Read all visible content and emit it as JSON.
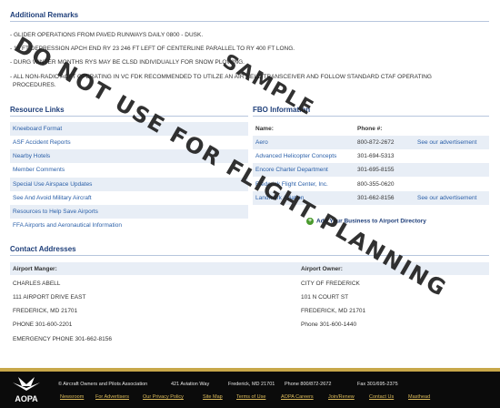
{
  "remarks": {
    "title": "Additional Remarks",
    "items": [
      "- GLIDER OPERATIONS FROM PAVED RUNWAYS DAILY 0800 - DUSK.",
      "- 15 FT DEPRESSION APCH END RY 23 246 FT LEFT OF CENTERLINE PARALLEL TO RY 400 FT LONG.",
      "- DURG WINTER MONTHS RYS MAY BE CLSD INDIVIDUALLY FOR SNOW PLOWING.",
      "- ALL NON-RADIO ACFT OPERATING IN VC FDK RECOMMENDED TO UTILZE AN AIR HELD TRANSCEIVER AND FOLLOW STANDARD CTAF OPERATING",
      "PROCEDURES."
    ]
  },
  "resources": {
    "title": "Resource Links",
    "items": [
      "Kneeboard Format",
      "ASF Accident Reports",
      "Nearby Hotels",
      "Member Comments",
      "Special Use Airspace Updates",
      "See And Avoid Military Aircraft",
      "Resources to Help Save Airports",
      "FFA Airports and Aeronautical Information"
    ]
  },
  "fbo": {
    "title": "FBO Information",
    "name_header": "Name:",
    "phone_header": "Phone #:",
    "rows": [
      {
        "name": "Aero",
        "phone": "800-872-2672",
        "adv": "See our advertisement"
      },
      {
        "name": "Advanced Helicopter Concepts",
        "phone": "301-694-5313",
        "adv": ""
      },
      {
        "name": "Encore Charter Department",
        "phone": "301-695-8155",
        "adv": ""
      },
      {
        "name": "Frederick Flight Center, Inc.",
        "phone": "800-355-0620",
        "adv": ""
      },
      {
        "name": "Landmark Aviation",
        "phone": "301-662-8156",
        "adv": "See our advertisement"
      }
    ],
    "add_business": "Add Your Business to Airport Directory"
  },
  "contacts": {
    "title": "Contact Addresses",
    "manager": {
      "label": "Airport Manger:",
      "lines": [
        "CHARLES ABELL",
        "111 AIRPORT DRIVE EAST",
        "FREDERICK, MD 21701",
        "PHONE 301-600-2201",
        "EMERGENCY PHONE 301-662-8156"
      ]
    },
    "owner": {
      "label": "Airport Owner:",
      "lines": [
        "CITY OF FREDERICK",
        "101 N COURT ST",
        "FREDERICK, MD 21701",
        "Phone 301-600-1440"
      ]
    }
  },
  "watermark": {
    "line1": "DO NOT USE FOR FLIGHT PLANNING",
    "line2": "SAMPLE"
  },
  "footer": {
    "logo_text": "AOPA",
    "info": [
      "© Aircraft Owners and Pilots Association",
      "421 Aviation Way",
      "Frederick, MD 21701",
      "Phone 800/872-2672",
      "Fax 301/695-2375"
    ],
    "links": [
      "Newsroom",
      "For Advertisers",
      "Our Privacy Policy",
      "Site Map",
      "Terms of Use",
      "AOPA Careers",
      "Join/Renew",
      "Contact Us",
      "Masthead"
    ]
  }
}
